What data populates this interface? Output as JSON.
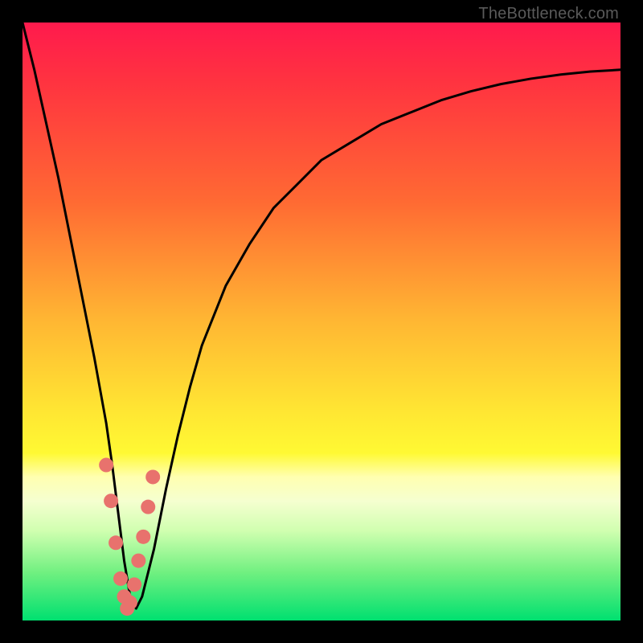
{
  "attribution": "TheBottleneck.com",
  "colors": {
    "background_frame": "#000000",
    "gradient_top": "#ff1a4d",
    "gradient_bottom": "#00e070",
    "curve": "#000000",
    "markers": "#e8726d"
  },
  "chart_data": {
    "type": "line",
    "title": "",
    "xlabel": "",
    "ylabel": "",
    "xlim": [
      0,
      100
    ],
    "ylim": [
      0,
      100
    ],
    "grid": false,
    "legend": false,
    "x": [
      0,
      2,
      4,
      6,
      8,
      10,
      12,
      14,
      15,
      16,
      17,
      18,
      19,
      20,
      22,
      24,
      26,
      28,
      30,
      34,
      38,
      42,
      46,
      50,
      55,
      60,
      65,
      70,
      75,
      80,
      85,
      90,
      95,
      100
    ],
    "values": [
      100,
      92,
      83,
      74,
      64,
      54,
      44,
      33,
      26,
      18,
      10,
      4,
      2,
      4,
      12,
      22,
      31,
      39,
      46,
      56,
      63,
      69,
      73,
      77,
      80,
      83,
      85,
      87,
      88.5,
      89.7,
      90.6,
      91.3,
      91.8,
      92.1
    ],
    "markers": {
      "x": [
        14.0,
        14.8,
        15.6,
        16.4,
        17.0,
        17.5,
        18.0,
        18.7,
        19.4,
        20.2,
        21.0,
        21.8
      ],
      "y": [
        26,
        20,
        13,
        7,
        4,
        2,
        3,
        6,
        10,
        14,
        19,
        24
      ]
    }
  }
}
